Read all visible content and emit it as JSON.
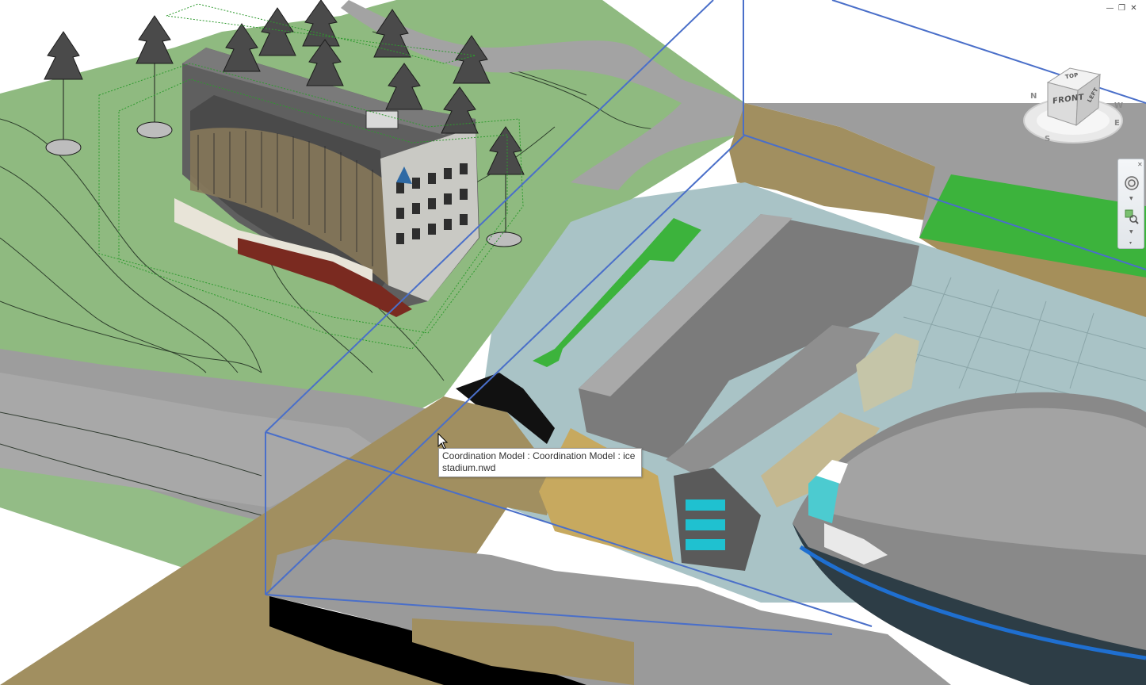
{
  "tooltip": {
    "line1": "Coordination Model : Coordination Model : ice",
    "line2": "stadium.nwd"
  },
  "viewcube": {
    "face_front": "FRONT",
    "face_top": "TOP",
    "face_side": "LEFT",
    "compass": [
      "N",
      "E",
      "S",
      "W"
    ]
  },
  "window_controls": {
    "minimize_icon": "minimize-icon",
    "restore_icon": "restore-icon",
    "close_icon": "close-icon"
  },
  "colors": {
    "terrain_green": "#8fba80",
    "road_gray": "#9b9b9b",
    "sand": "#a18f60",
    "water": "#a9c3c6",
    "grass_bright": "#3cb33c",
    "section_box": "#4a6fc9"
  }
}
